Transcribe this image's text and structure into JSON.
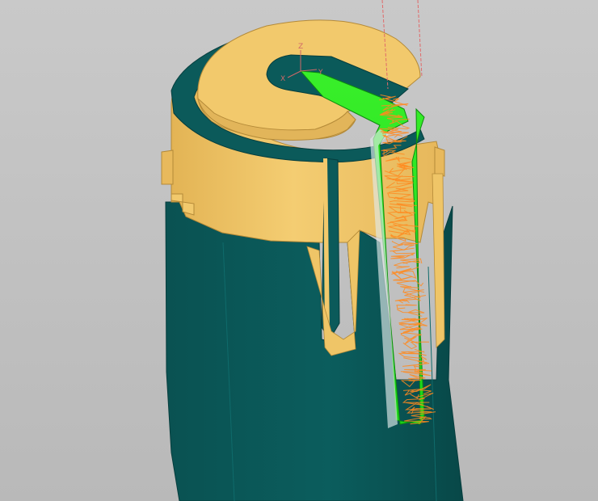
{
  "viewport": {
    "background": "#c0c0c0"
  },
  "colors": {
    "part_top": "#f2c96c",
    "part_side": "#efc567",
    "part_shade": "#d9a94a",
    "body_dark": "#0b5a5a",
    "body_edge": "#073f3f",
    "selected_face": "#22e61e",
    "toolpath": "#ff8a1f",
    "tool_axis_line": "#e06a6a"
  },
  "axis_triad": {
    "x_label": "X",
    "y_label": "Y",
    "z_label": "Z"
  }
}
